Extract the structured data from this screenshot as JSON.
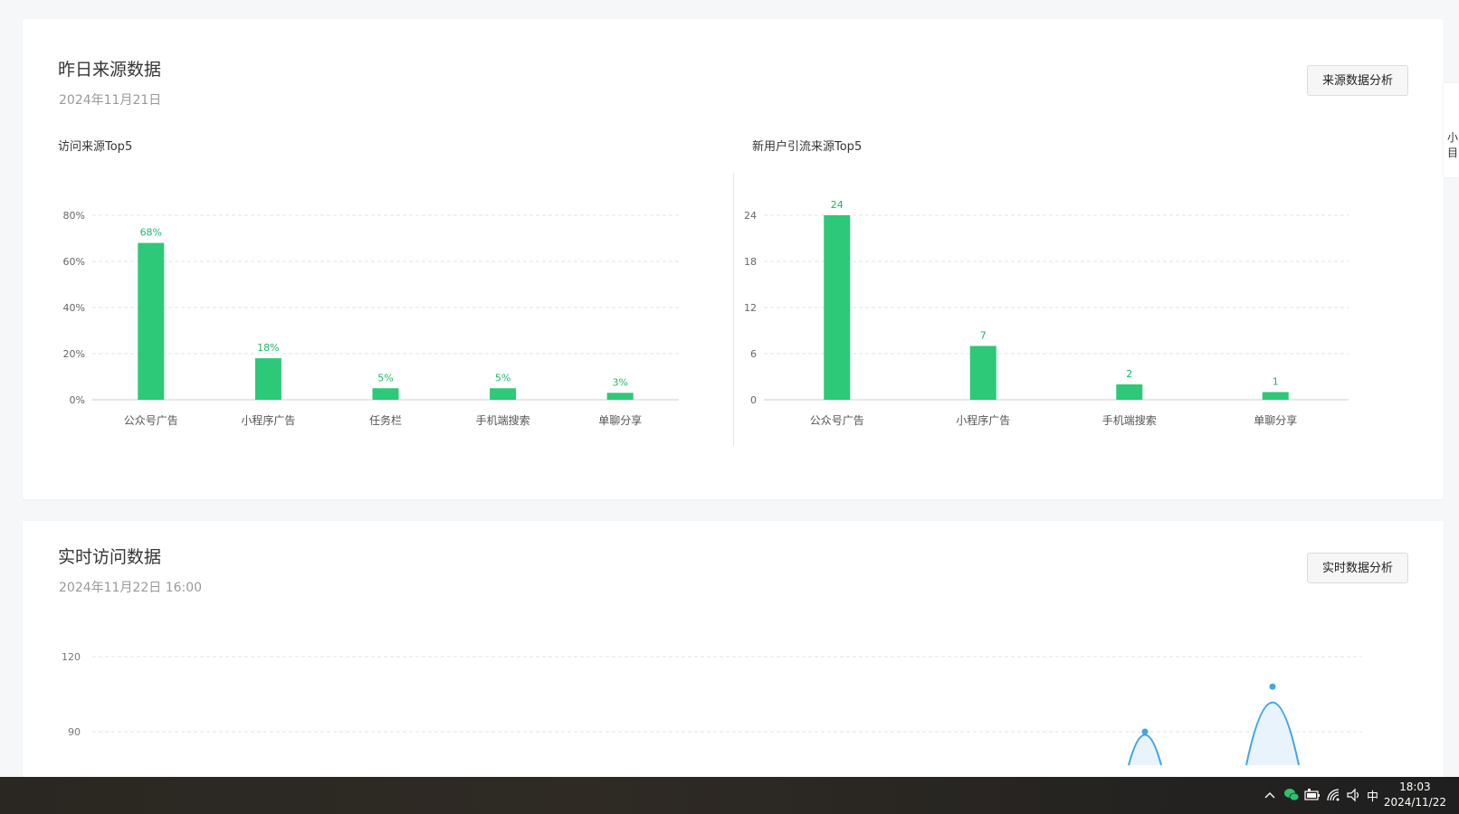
{
  "source_card": {
    "title": "昨日来源数据",
    "date": "2024年11月21日",
    "button_label": "来源数据分析"
  },
  "realtime_card": {
    "title": "实时访问数据",
    "date": "2024年11月22日 16:00",
    "button_label": "实时数据分析"
  },
  "edge_widget": {
    "line1": "小",
    "line2": "目"
  },
  "taskbar": {
    "ime_label": "中",
    "time": "18:03",
    "date": "2024/11/22"
  },
  "colors": {
    "bar": "#2dc878",
    "bar_label": "#1fb865",
    "line": "#42a5e6",
    "line_fill": "#e8f3fc"
  },
  "icons": [
    "chevron-up-icon",
    "wechat-icon",
    "battery-icon",
    "wifi-icon",
    "speaker-icon"
  ],
  "chart_data": [
    {
      "type": "bar",
      "title": "访问来源Top5",
      "categories": [
        "公众号广告",
        "小程序广告",
        "任务栏",
        "手机端搜索",
        "单聊分享"
      ],
      "values": [
        68,
        18,
        5,
        5,
        3
      ],
      "value_labels": [
        "68%",
        "18%",
        "5%",
        "5%",
        "3%"
      ],
      "yticks": [
        "0%",
        "20%",
        "40%",
        "60%",
        "80%"
      ],
      "ytick_values": [
        0,
        20,
        40,
        60,
        80
      ],
      "ylim": [
        0,
        80
      ],
      "grid": true
    },
    {
      "type": "bar",
      "title": "新用户引流来源Top5",
      "categories": [
        "公众号广告",
        "小程序广告",
        "手机端搜索",
        "单聊分享"
      ],
      "values": [
        24,
        7,
        2,
        1
      ],
      "value_labels": [
        "24",
        "7",
        "2",
        "1"
      ],
      "yticks": [
        "0",
        "6",
        "12",
        "18",
        "24"
      ],
      "ytick_values": [
        0,
        6,
        12,
        18,
        24
      ],
      "ylim": [
        0,
        24
      ],
      "grid": true
    },
    {
      "type": "area",
      "yticks": [
        "90",
        "120"
      ],
      "ytick_values": [
        90,
        120
      ],
      "grid": true,
      "series": [
        {
          "peaks": [
            90,
            108
          ]
        }
      ]
    }
  ]
}
